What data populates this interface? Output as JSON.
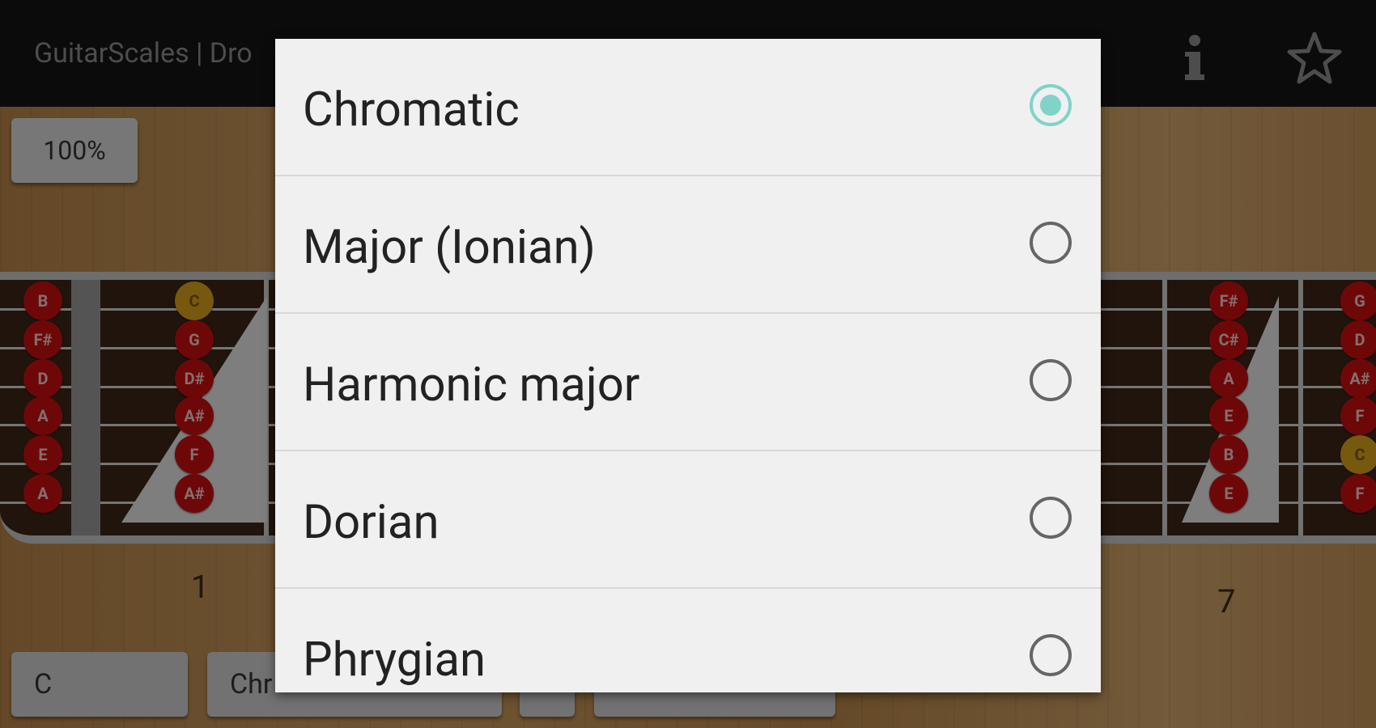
{
  "app": {
    "title": "GuitarScales | Dro"
  },
  "toolbar": {
    "info_icon": "info-icon",
    "favorite_icon": "star-outline-icon"
  },
  "fretboard": {
    "zoom_label": "100%",
    "left_section": {
      "open_notes": [
        "B",
        "F#",
        "D",
        "A",
        "E",
        "A"
      ],
      "fret1_notes": [
        "C",
        "G",
        "D#",
        "A#",
        "F",
        "A#"
      ],
      "fret1_root_index": 0,
      "fret_number": "1"
    },
    "right_section": {
      "fret7_notes": [
        "F#",
        "C#",
        "A",
        "E",
        "B",
        "E"
      ],
      "edge_notes": [
        "G",
        "D",
        "A#",
        "F",
        "C",
        "F"
      ],
      "edge_root_index": 4,
      "fret_number": "7"
    }
  },
  "bottom_bar": {
    "key_label": "C",
    "scale_label": "Chr"
  },
  "dialog": {
    "selected_index": 0,
    "options": [
      {
        "label": "Chromatic"
      },
      {
        "label": "Major (Ionian)"
      },
      {
        "label": "Harmonic major"
      },
      {
        "label": "Dorian"
      },
      {
        "label": "Phrygian"
      }
    ]
  },
  "colors": {
    "note_red": "#c90f0f",
    "root_gold": "#d8a01a",
    "radio_accent": "#7fd3c9",
    "dialog_bg": "#f0f0f0"
  }
}
